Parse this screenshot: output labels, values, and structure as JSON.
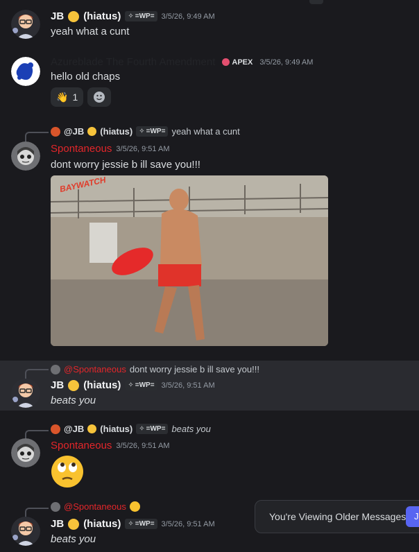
{
  "messages": [
    {
      "author": "JB",
      "status": "(hiatus)",
      "tag": "=WP=",
      "timestamp": "3/5/26, 9:49 AM",
      "text": "yeah what a cunt"
    },
    {
      "author": "Azureblade The Fourth Amendment",
      "tag": "APEX",
      "timestamp": "3/5/26, 9:49 AM",
      "text": "hello old chaps",
      "reactions": [
        {
          "emoji": "waving-hand",
          "count": "1"
        }
      ]
    },
    {
      "reply": {
        "author": "@JB",
        "status": "(hiatus)",
        "tag": "=WP=",
        "text": "yeah what a cunt"
      },
      "author": "Spontaneous",
      "timestamp": "3/5/26, 9:51 AM",
      "text": "dont worry jessie b ill save you!!!",
      "gif_label": "BAYWATCH"
    },
    {
      "reply": {
        "author": "@Spontaneous",
        "text": "dont worry jessie b ill save you!!!"
      },
      "author": "JB",
      "status": "(hiatus)",
      "tag": "=WP=",
      "timestamp": "3/5/26, 9:51 AM",
      "text": "beats you"
    },
    {
      "reply": {
        "author": "@JB",
        "status": "(hiatus)",
        "tag": "=WP=",
        "text": "beats you"
      },
      "author": "Spontaneous",
      "timestamp": "3/5/26, 9:51 AM",
      "emoji": "face-with-rolling-eyes"
    },
    {
      "reply": {
        "author": "@Spontaneous"
      },
      "author": "JB",
      "status": "(hiatus)",
      "tag": "=WP=",
      "timestamp": "3/5/26, 9:51 AM",
      "text": "beats you"
    }
  ],
  "banner": {
    "text": "You're Viewing Older Messages",
    "button": "J"
  },
  "colors": {
    "background": "#1a1a1e",
    "mention": "#e3262a",
    "accent": "#5865f2"
  }
}
